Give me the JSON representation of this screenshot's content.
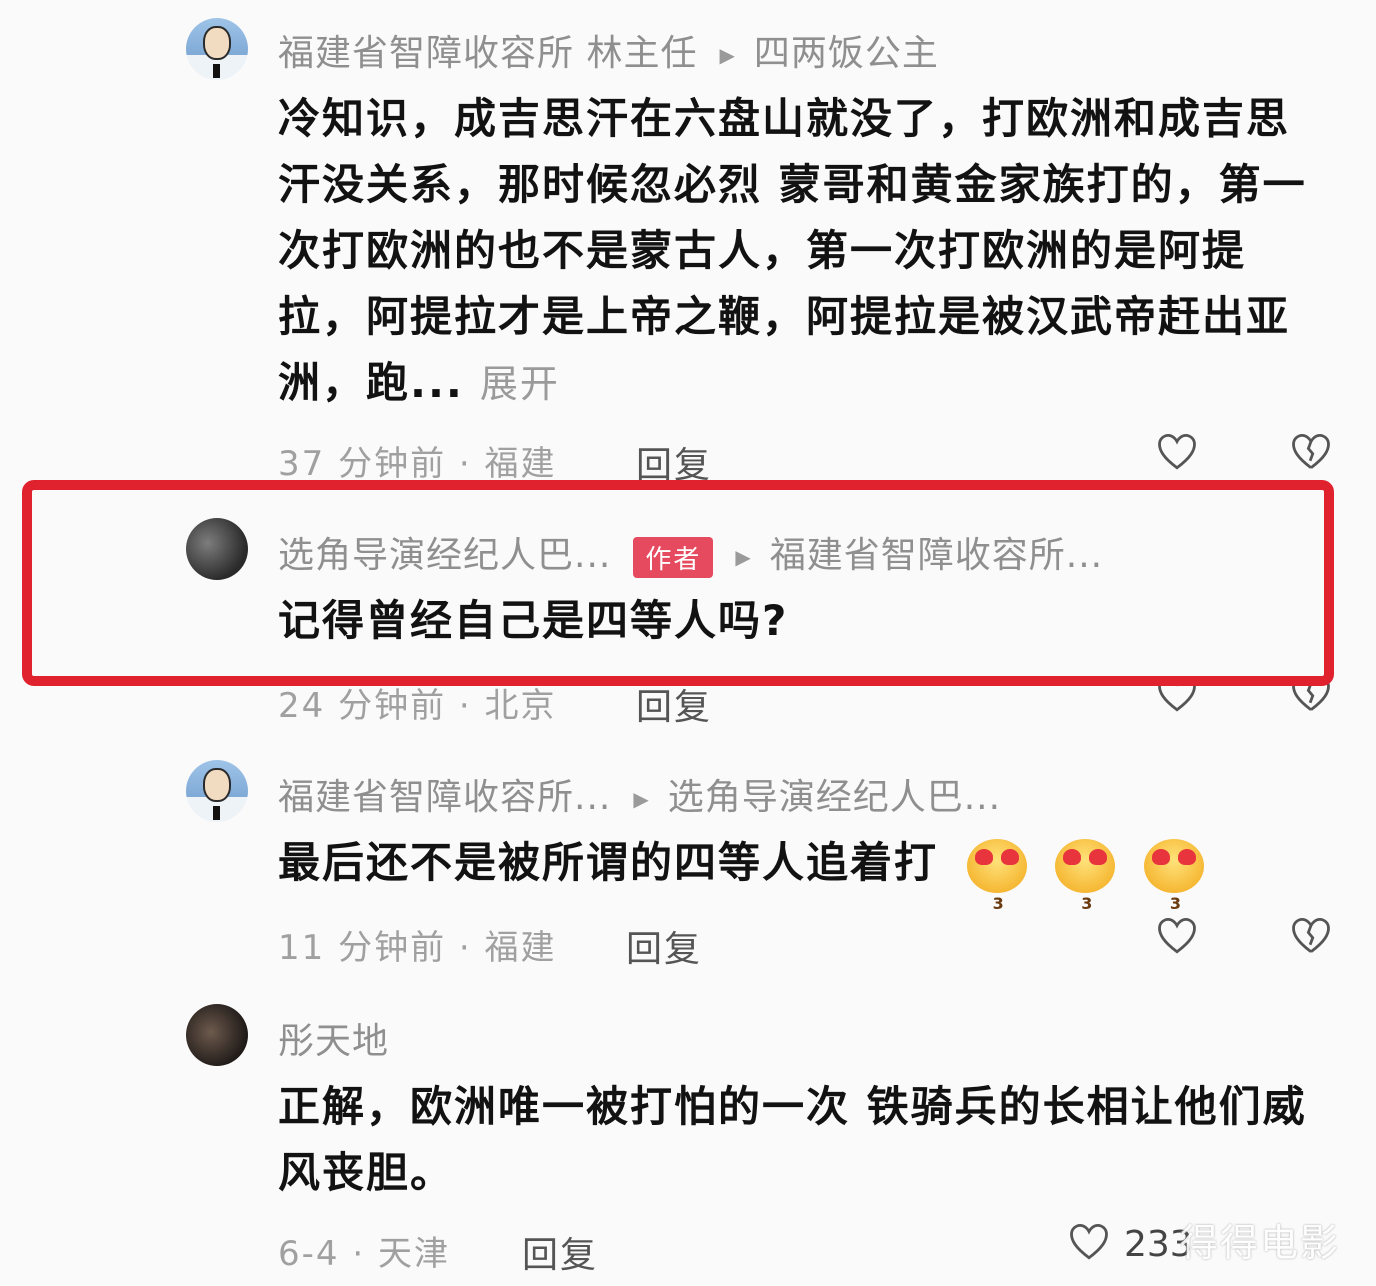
{
  "comments": [
    {
      "user": "福建省智障收容所 林主任",
      "reply_to": "四两饭公主",
      "text": "冷知识，成吉思汗在六盘山就没了，打欧洲和成吉思汗没关系，那时候忽必烈 蒙哥和黄金家族打的，第一次打欧洲的也不是蒙古人，第一次打欧洲的是阿提拉，阿提拉才是上帝之鞭，阿提拉是被汉武帝赶出亚洲，跑...",
      "expand": "展开",
      "meta": "37 分钟前 · 福建",
      "reply": "回复"
    },
    {
      "user": "选角导演经纪人巴...",
      "badge": "作者",
      "reply_to": "福建省智障收容所...",
      "text": "记得曾经自己是四等人吗?",
      "meta": "24 分钟前 · 北京",
      "reply": "回复"
    },
    {
      "user": "福建省智障收容所...",
      "reply_to": "选角导演经纪人巴...",
      "text": "最后还不是被所谓的四等人追着打",
      "emojis": [
        "heart-eyes-emoji",
        "heart-eyes-emoji",
        "heart-eyes-emoji"
      ],
      "meta": "11 分钟前 · 福建",
      "reply": "回复"
    },
    {
      "user": "彤天地",
      "text": "正解，欧洲唯一被打怕的一次 铁骑兵的长相让他们威风丧胆。",
      "meta": "6-4 · 天津",
      "reply": "回复",
      "likes": "233"
    }
  ],
  "watermark": "得得电影",
  "colors": {
    "highlight_border": "#e0222e",
    "author_badge": "#e64a5f"
  }
}
